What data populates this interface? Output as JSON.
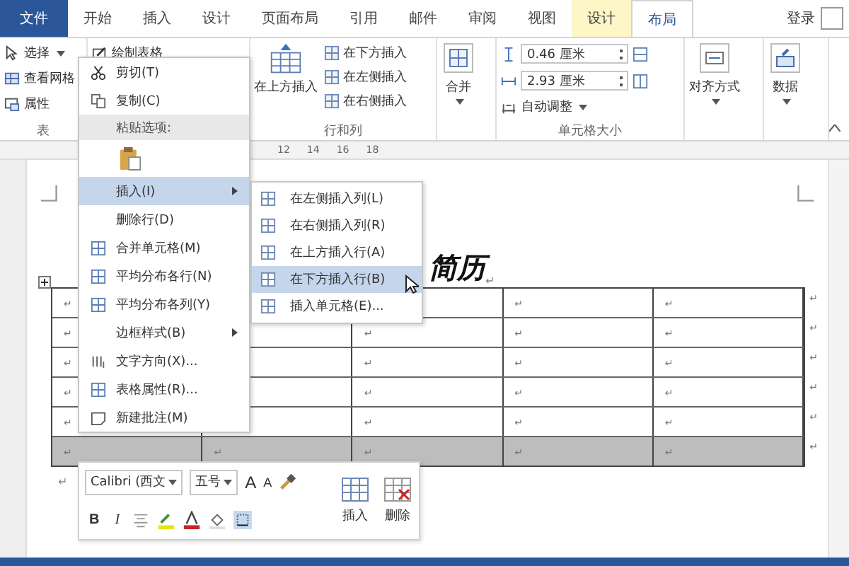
{
  "tabs": [
    {
      "label": "文件",
      "kind": "file",
      "selected": false
    },
    {
      "label": "开始",
      "kind": "plain",
      "selected": false
    },
    {
      "label": "插入",
      "kind": "plain",
      "selected": false
    },
    {
      "label": "设计",
      "kind": "plain",
      "selected": false
    },
    {
      "label": "页面布局",
      "kind": "plain",
      "selected": false
    },
    {
      "label": "引用",
      "kind": "plain",
      "selected": false
    },
    {
      "label": "邮件",
      "kind": "plain",
      "selected": false
    },
    {
      "label": "审阅",
      "kind": "plain",
      "selected": false
    },
    {
      "label": "视图",
      "kind": "plain",
      "selected": false
    },
    {
      "label": "设计",
      "kind": "contextual",
      "selected": false
    },
    {
      "label": "布局",
      "kind": "contextual",
      "selected": true
    }
  ],
  "account": {
    "label": "登录"
  },
  "ribbon": {
    "table": {
      "label": "表",
      "items": [
        "选择",
        "查看网格",
        "属性"
      ]
    },
    "draw": {
      "items": [
        "绘制表格"
      ]
    },
    "rows_cols": {
      "label": "行和列",
      "big": "在上方插入",
      "items": [
        "在下方插入",
        "在左侧插入",
        "在右侧插入"
      ]
    },
    "merge": {
      "big": "合并"
    },
    "cell_size": {
      "label": "单元格大小",
      "height": "0.46 厘米",
      "width": "2.93 厘米",
      "autofit": "自动调整"
    },
    "align": {
      "big": "对齐方式"
    },
    "data": {
      "big": "数据"
    }
  },
  "ruler": {
    "labels": [
      "12",
      "14",
      "16",
      "18"
    ]
  },
  "document": {
    "title": "简历",
    "title_mark": "↵",
    "after_table": "↵",
    "rows": [
      {
        "selected": false,
        "end": "↵",
        "cells": [
          {
            "text": "↵"
          },
          {},
          {},
          {
            "text": "↵"
          },
          {
            "text": "↵"
          }
        ]
      },
      {
        "selected": false,
        "end": "↵",
        "cells": [
          {
            "text": "↵"
          },
          {},
          {
            "text": "↵"
          },
          {
            "text": "↵"
          },
          {
            "text": "↵"
          }
        ]
      },
      {
        "selected": false,
        "end": "↵",
        "cells": [
          {
            "text": "↵"
          },
          {},
          {
            "text": "↵"
          },
          {
            "text": "↵"
          },
          {
            "text": "↵"
          }
        ]
      },
      {
        "selected": false,
        "end": "↵",
        "cells": [
          {
            "text": "↵"
          },
          {},
          {
            "text": "↵"
          },
          {
            "text": "↵"
          },
          {
            "text": "↵"
          }
        ]
      },
      {
        "selected": false,
        "end": "↵",
        "cells": [
          {
            "text": "↵"
          },
          {},
          {
            "text": "↵"
          },
          {
            "text": "↵"
          },
          {
            "text": "↵"
          }
        ]
      },
      {
        "selected": true,
        "end": "↵",
        "cells": [
          {
            "text": "↵"
          },
          {
            "text": "↵"
          },
          {
            "text": "↵"
          },
          {
            "text": "↵"
          },
          {
            "text": "↵"
          }
        ]
      }
    ]
  },
  "context_menu": {
    "items": [
      {
        "kind": "item",
        "label": "剪切(T)",
        "selected": false
      },
      {
        "kind": "item",
        "label": "复制(C)",
        "selected": false
      },
      {
        "kind": "header",
        "label": "粘贴选项:"
      },
      {
        "kind": "paste"
      },
      {
        "kind": "submenu",
        "label": "插入(I)",
        "selected": true
      },
      {
        "kind": "item",
        "label": "删除行(D)",
        "selected": false
      },
      {
        "kind": "item",
        "label": "合并单元格(M)",
        "selected": false
      },
      {
        "kind": "item",
        "label": "平均分布各行(N)",
        "selected": false
      },
      {
        "kind": "item",
        "label": "平均分布各列(Y)",
        "selected": false
      },
      {
        "kind": "submenu",
        "label": "边框样式(B)",
        "selected": false
      },
      {
        "kind": "item",
        "label": "文字方向(X)...",
        "selected": false
      },
      {
        "kind": "item",
        "label": "表格属性(R)...",
        "selected": false
      },
      {
        "kind": "item",
        "label": "新建批注(M)",
        "selected": false
      }
    ]
  },
  "submenu": {
    "items": [
      {
        "label": "在左侧插入列(L)",
        "selected": false
      },
      {
        "label": "在右侧插入列(R)",
        "selected": false
      },
      {
        "label": "在上方插入行(A)",
        "selected": false
      },
      {
        "label": "在下方插入行(B)",
        "selected": true
      },
      {
        "label": "插入单元格(E)...",
        "selected": false
      }
    ]
  },
  "mini_toolbar": {
    "font": "Calibri (西文",
    "size": "五号",
    "grow": "A",
    "shrink": "A",
    "bold": "B",
    "italic": "I",
    "insert": "插入",
    "delete": "删除"
  }
}
